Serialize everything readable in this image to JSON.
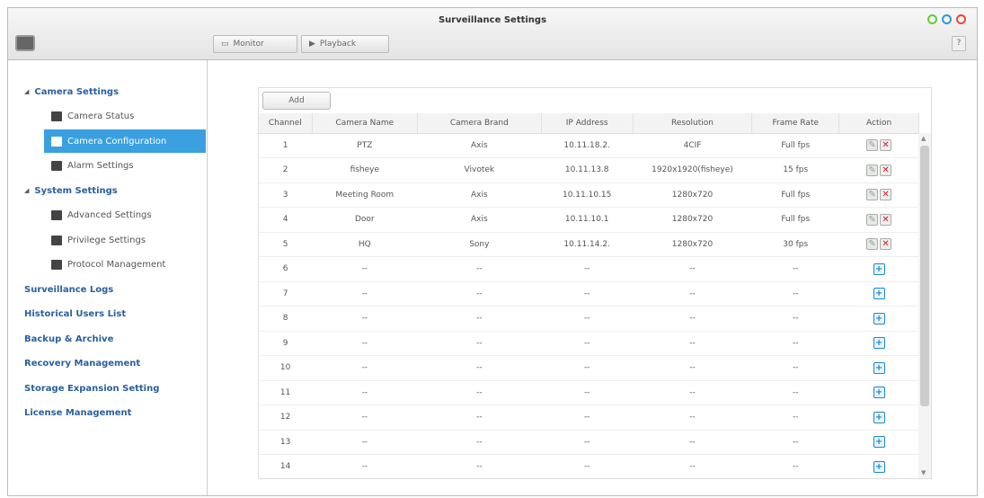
{
  "window": {
    "title": "Surveillance Settings",
    "help": "?"
  },
  "toolbar": {
    "monitor": "Monitor",
    "playback": "Playback"
  },
  "sidebar": [
    {
      "label": "Camera Settings",
      "type": "grp"
    },
    {
      "label": "Camera Status",
      "type": "sub"
    },
    {
      "label": "Camera Configuration",
      "type": "sel"
    },
    {
      "label": "Alarm Settings",
      "type": "sub"
    },
    {
      "label": "System Settings",
      "type": "grp"
    },
    {
      "label": "Advanced Settings",
      "type": "sub"
    },
    {
      "label": "Privilege Settings",
      "type": "sub"
    },
    {
      "label": "Protocol Management",
      "type": "sub"
    },
    {
      "label": "Surveillance Logs",
      "type": "top"
    },
    {
      "label": "Historical Users List",
      "type": "top"
    },
    {
      "label": "Backup & Archive",
      "type": "top"
    },
    {
      "label": "Recovery Management",
      "type": "top"
    },
    {
      "label": "Storage Expansion Setting",
      "type": "top"
    },
    {
      "label": "License Management",
      "type": "top"
    }
  ],
  "table": {
    "add_label": "Add",
    "headers": [
      "Channel",
      "Camera Name",
      "Camera Brand",
      "IP Address",
      "Resolution",
      "Frame Rate",
      "Action"
    ],
    "rows": [
      [
        "1",
        "PTZ",
        "Axis",
        "10.11.18.2.",
        "4CIF",
        "Full fps"
      ],
      [
        "2",
        "fisheye",
        "Vivotek",
        "10.11.13.8",
        "1920x1920(fisheye)",
        "15 fps"
      ],
      [
        "3",
        "Meeting Room",
        "Axis",
        "10.11.10.15",
        "1280x720",
        "Full fps"
      ],
      [
        "4",
        "Door",
        "Axis",
        "10.11.10.1",
        "1280x720",
        "Full fps"
      ],
      [
        "5",
        "HQ",
        "Sony",
        "10.11.14.2.",
        "1280x720",
        "30 fps"
      ],
      [
        "6",
        "--",
        "--",
        "--",
        "--",
        "--"
      ],
      [
        "7",
        "--",
        "--",
        "--",
        "--",
        "--"
      ],
      [
        "8",
        "--",
        "--",
        "--",
        "--",
        "--"
      ],
      [
        "9",
        "--",
        "--",
        "--",
        "--",
        "--"
      ],
      [
        "10",
        "--",
        "--",
        "--",
        "--",
        "--"
      ],
      [
        "11",
        "--",
        "--",
        "--",
        "--",
        "--"
      ],
      [
        "12",
        "--",
        "--",
        "--",
        "--",
        "--"
      ],
      [
        "13",
        "--",
        "--",
        "--",
        "--",
        "--"
      ],
      [
        "14",
        "--",
        "--",
        "--",
        "--",
        "--"
      ]
    ]
  },
  "colors": {
    "accent": "#3aa0e0",
    "link": "#2a5f9e"
  }
}
